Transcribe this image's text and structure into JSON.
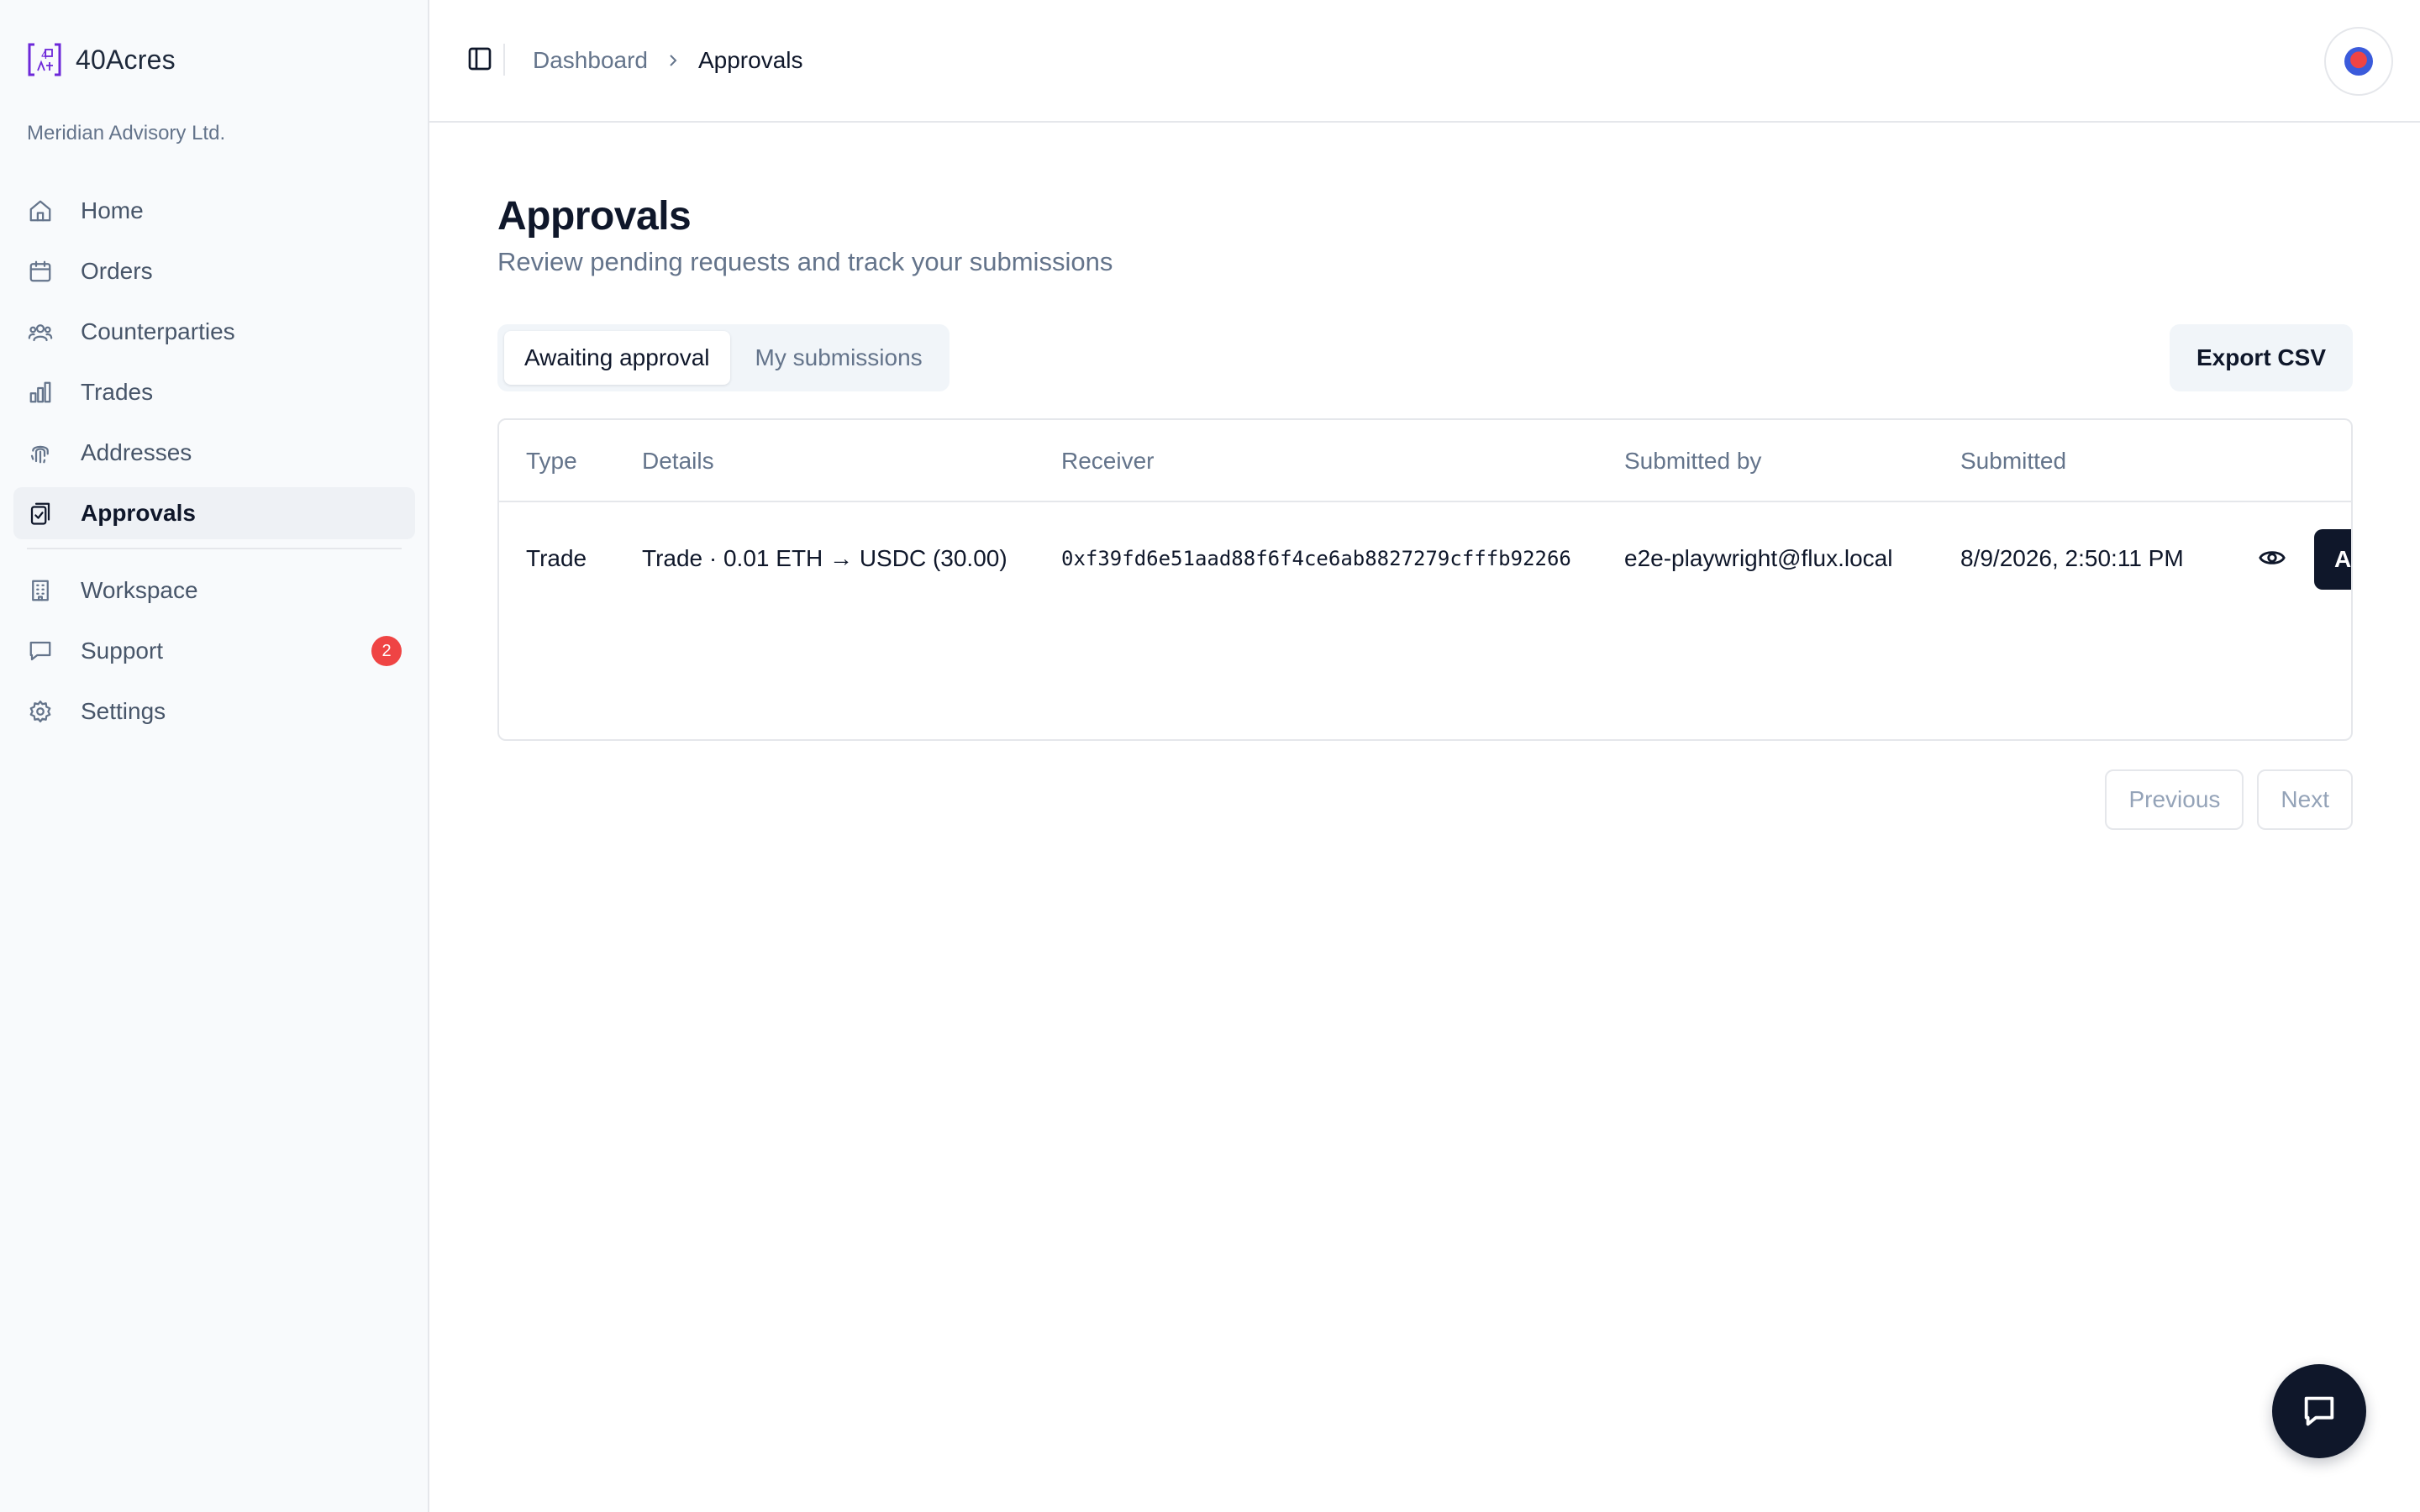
{
  "brand": {
    "name": "40Acres",
    "logo_icon": "brand-logo-icon",
    "accent_color": "#6d28d9"
  },
  "org": {
    "name": "Meridian Advisory Ltd."
  },
  "sidebar": {
    "items": [
      {
        "label": "Home",
        "icon": "home-icon"
      },
      {
        "label": "Orders",
        "icon": "calendar-icon"
      },
      {
        "label": "Counterparties",
        "icon": "users-icon"
      },
      {
        "label": "Trades",
        "icon": "bar-chart-icon"
      },
      {
        "label": "Addresses",
        "icon": "fingerprint-icon"
      },
      {
        "label": "Approvals",
        "icon": "clipboard-check-icon",
        "active": true
      },
      {
        "label": "Workspace",
        "icon": "building-icon"
      },
      {
        "label": "Support",
        "icon": "message-icon",
        "badge": "2"
      },
      {
        "label": "Settings",
        "icon": "gear-icon"
      }
    ]
  },
  "header": {
    "breadcrumb": [
      "Dashboard",
      "Approvals"
    ]
  },
  "main": {
    "title": "Approvals",
    "subtitle": "Review pending requests and track your submissions",
    "tabs": [
      {
        "label": "Awaiting approval",
        "active": true
      },
      {
        "label": "My submissions",
        "active": false
      }
    ],
    "export_label": "Export CSV",
    "table": {
      "columns": [
        "Type",
        "Details",
        "Receiver",
        "Submitted by",
        "Submitted"
      ],
      "rows": [
        {
          "type": "Trade",
          "details": "Trade · 0.01 ETH → USDC (30.00)",
          "receiver": "0xf39fd6e51aad88f6f4ce6ab8827279cfffb92266",
          "submitted_by": "e2e-playwright@flux.local",
          "submitted": "8/9/2026, 2:50:11 PM",
          "action_label": "A"
        }
      ]
    },
    "pagination": {
      "previous": "Previous",
      "next": "Next"
    }
  },
  "colors": {
    "badge": "#ef4444",
    "primary": "#0f172a"
  }
}
